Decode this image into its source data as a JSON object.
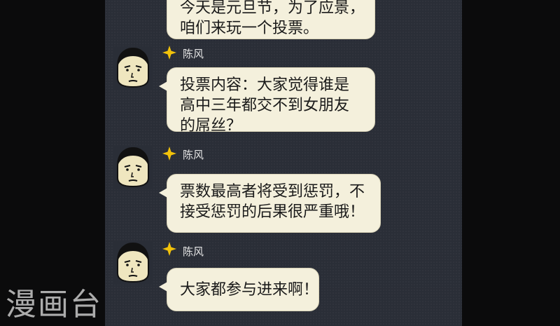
{
  "messages": [
    {
      "lines": [
        "今天是元旦节，为了应景，",
        "咱们来玩一个投票。"
      ]
    },
    {
      "sender": "陈风",
      "lines": [
        "投票内容：大家觉得谁是",
        "高中三年都交不到女朋友",
        "的屌丝？"
      ]
    },
    {
      "sender": "陈风",
      "lines": [
        "票数最高者将受到惩罚，不",
        "接受惩罚的后果很严重哦！"
      ]
    },
    {
      "sender": "陈风",
      "lines": [
        "大家都参与进来啊！"
      ]
    }
  ],
  "watermark": "漫画台",
  "icons": [
    "avatar-face-icon",
    "star-badge-icon"
  ],
  "colors": {
    "panel": "#2a2e37",
    "bubble": "#f4f0dc",
    "star": "#f2c20a"
  }
}
